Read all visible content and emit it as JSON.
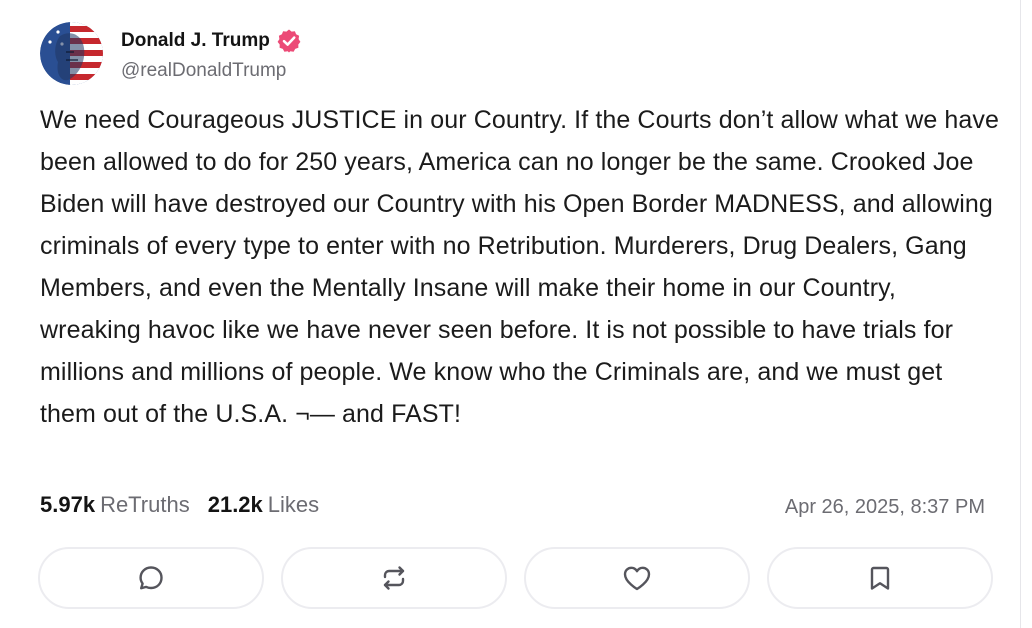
{
  "author": {
    "display_name": "Donald J. Trump",
    "handle": "@realDonaldTrump",
    "verified": true,
    "verified_color": "#ec4b77",
    "avatar_icon": "flag-portrait-avatar"
  },
  "post": {
    "text": "We need Courageous JUSTICE in our Country. If the Courts don’t allow what we have been allowed to do for 250 years, America can no longer be the same. Crooked Joe Biden will have destroyed our Country with his Open Border MADNESS, and allowing criminals of every type to enter with no Retribution. Murderers, Drug Dealers, Gang Members, and even the Mentally Insane will make their home in our Country, wreaking havoc like we have never seen before. It is not possible to have trials for millions and millions of people. We know who the Criminals are, and we must get them out of the U.S.A. ¬— and FAST!"
  },
  "stats": {
    "retruths_count": "5.97k",
    "retruths_label": "ReTruths",
    "likes_count": "21.2k",
    "likes_label": "Likes",
    "timestamp": "Apr 26, 2025, 8:37 PM"
  },
  "actions": [
    {
      "name": "reply",
      "icon": "comment-icon"
    },
    {
      "name": "retruth",
      "icon": "repost-icon"
    },
    {
      "name": "like",
      "icon": "heart-icon"
    },
    {
      "name": "bookmark",
      "icon": "bookmark-icon"
    }
  ],
  "colors": {
    "text": "#1b1b1b",
    "muted": "#6c6c72",
    "border": "#ececf0",
    "icon": "#55555c"
  }
}
